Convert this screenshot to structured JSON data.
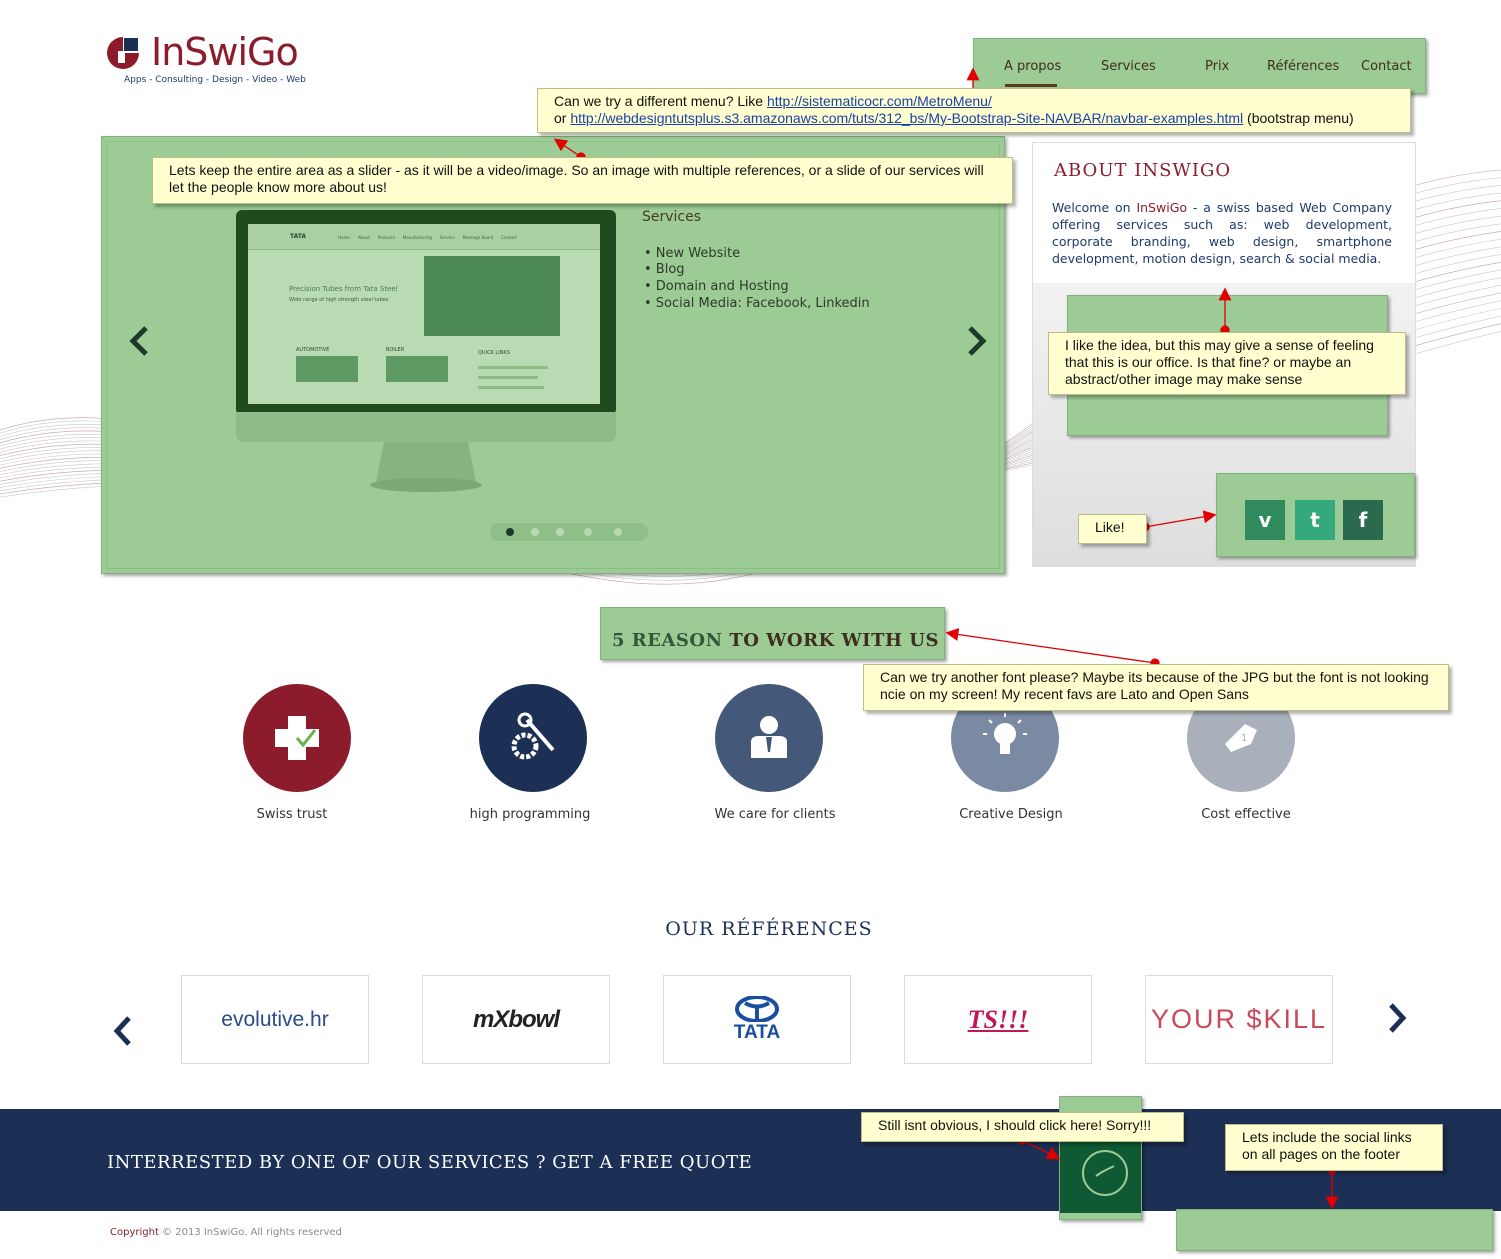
{
  "logo": {
    "name": "InSwiGo",
    "tagline": "Apps - Consulting - Design - Video - Web"
  },
  "nav": {
    "items": [
      {
        "label": "A propos",
        "active": true
      },
      {
        "label": "Services"
      },
      {
        "label": "Prix"
      },
      {
        "label": "Références"
      },
      {
        "label": "Contact"
      }
    ]
  },
  "slider": {
    "services_title": "Services",
    "services_items": [
      "• New Website",
      "• Blog",
      "• Domain and Hosting",
      "• Social Media: Facebook, Linkedin"
    ],
    "screen": {
      "brand": "TATA",
      "headline": "Precision Tubes from Tata Steel",
      "subline": "Wide range of high strength steel tubes",
      "nav_links": [
        "Home",
        "About",
        "Products",
        "Manufacturing",
        "Service",
        "Message Board",
        "Contact"
      ],
      "sections": [
        "AUTOMOTIVE",
        "BOILER",
        "QUICK LINKS"
      ]
    },
    "slide_count": 5,
    "active_slide": 1
  },
  "about": {
    "title": "ABOUT INSWIGO",
    "text_prefix": "Welcome on ",
    "text_brand": "InSwiGo",
    "text_rest": " - a swiss based Web Company offering services such as: web development, corporate branding, web design, smartphone development, motion design, search & social media."
  },
  "social": [
    {
      "icon": "vimeo-icon",
      "glyph": "v",
      "color": "#2f8a5e"
    },
    {
      "icon": "twitter-icon",
      "glyph": "t",
      "color": "#35a87e"
    },
    {
      "icon": "facebook-icon",
      "glyph": "f",
      "color": "#2a6a4e"
    }
  ],
  "reasons": {
    "title_prefix": "5 REASON ",
    "title_rest": "TO WORK WITH US",
    "items": [
      {
        "label": "Swiss trust",
        "icon": "swiss-cross-icon",
        "color": "#8c1c2c"
      },
      {
        "label": "high programming",
        "icon": "wrench-gear-icon",
        "color": "#1c2f55"
      },
      {
        "label": "We care for clients",
        "icon": "person-icon",
        "color": "#44587a"
      },
      {
        "label": "Creative Design",
        "icon": "lightbulb-icon",
        "color": "#7a8aa3"
      },
      {
        "label": "Cost effective",
        "icon": "price-tag-icon",
        "color": "#a9b0bc"
      }
    ]
  },
  "references": {
    "title": "OUR RÉFÉRENCES",
    "logos": [
      "evolutive.hr",
      "mXbowl",
      "TATA",
      "TS!!!",
      "YOUR $KILL"
    ]
  },
  "band": {
    "text": "INTERRESTED BY ONE OF OUR SERVICES ? GET A FREE QUOTE"
  },
  "footer": {
    "copyright_word": "Copyright",
    "copyright_rest": " © 2013 InSwiGo. All rights reserved"
  },
  "notes": {
    "menu": {
      "line1_prefix": "Can we try a different menu? Like ",
      "link1": "http://sistematicocr.com/MetroMenu/",
      "line2_prefix": "or ",
      "link2": "http://webdesigntutsplus.s3.amazonaws.com/tuts/312_bs/My-Bootstrap-Site-NAVBAR/navbar-examples.html",
      "line2_suffix": " (bootstrap menu)"
    },
    "slider": "Lets keep the entire area as a slider - as it will be a video/image. So an image with multiple references, or a slide of our services will let the people know more about us!",
    "office": "I like the idea, but this may give a sense of feeling that this is our office. Is that fine? or maybe an abstract/other image may make sense",
    "like": "Like!",
    "font": "Can we try another font please? Maybe its because of the JPG but the font is not looking ncie on my screen! My recent favs are Lato and Open Sans",
    "click": "Still isnt obvious, I should click here! Sorry!!!",
    "social_footer": "Lets include the social links on all pages on the footer"
  }
}
